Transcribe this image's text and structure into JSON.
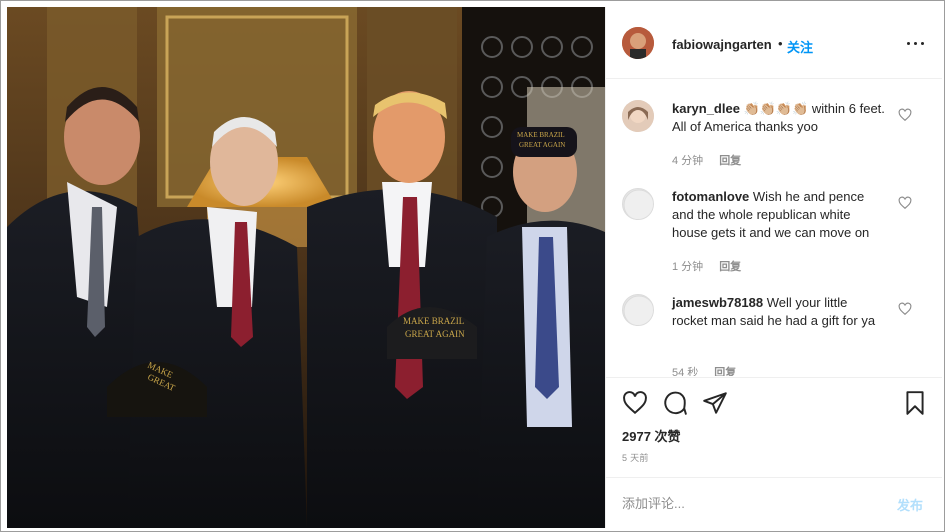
{
  "post": {
    "username": "fabiowajngarten",
    "separator": "•",
    "follow_label": "关注",
    "more_icon": "more-horizontal-icon"
  },
  "photo": {
    "hat_text_line1": "MAKE BRAZIL",
    "hat_text_line2": "GREAT AGAIN"
  },
  "comments": [
    {
      "username": "karyn_dlee",
      "text": " 👏🏼👏🏼👏🏼👏🏼 within 6 feet. All of America thanks yoo",
      "time": "4 分钟",
      "reply": "回复"
    },
    {
      "username": "fotomanlove",
      "text": " Wish he and pence and the whole republican white house gets it and we can move on",
      "time": "1 分钟",
      "reply": "回复"
    },
    {
      "username": "jameswb78188",
      "text": " Well your little rocket man said he had a gift for ya",
      "time": "54 秒",
      "reply": "回复"
    }
  ],
  "actions": {
    "like_icon": "heart-icon",
    "comment_icon": "comment-icon",
    "share_icon": "share-icon",
    "save_icon": "bookmark-icon"
  },
  "likes_text": "2977 次赞",
  "time_ago": "5 天前",
  "add_comment": {
    "placeholder": "添加评论...",
    "post_label": "发布"
  },
  "colors": {
    "accent": "#0095f6",
    "post_disabled": "#b2dffc",
    "muted": "#8e8e8e"
  }
}
